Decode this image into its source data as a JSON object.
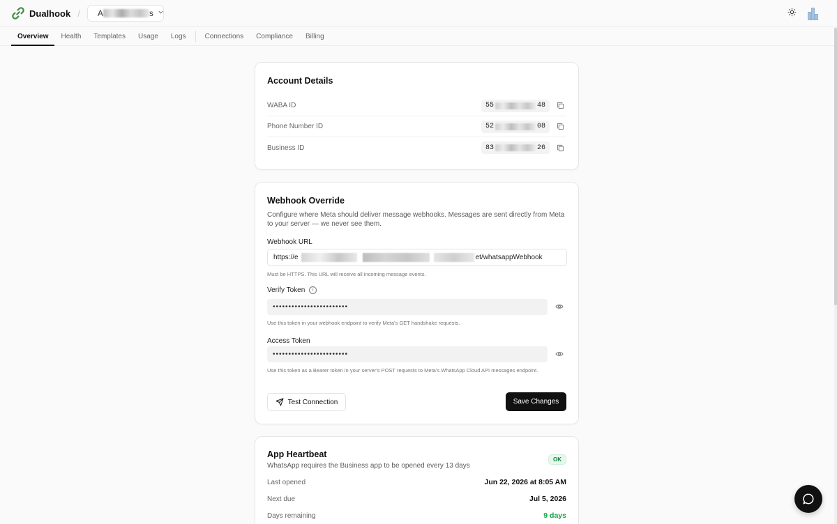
{
  "app": {
    "brand": "Dualhook",
    "separator": "/",
    "account_prefix": "A",
    "account_suffix": "s"
  },
  "tabs": [
    {
      "label": "Overview",
      "active": true
    },
    {
      "label": "Health"
    },
    {
      "label": "Templates"
    },
    {
      "label": "Usage"
    },
    {
      "label": "Logs"
    },
    {
      "label": "Connections"
    },
    {
      "label": "Compliance"
    },
    {
      "label": "Billing"
    }
  ],
  "account_details": {
    "title": "Account Details",
    "rows": [
      {
        "label": "WABA ID",
        "prefix": "55",
        "suffix": "48"
      },
      {
        "label": "Phone Number ID",
        "prefix": "52",
        "suffix": "08"
      },
      {
        "label": "Business ID",
        "prefix": "83",
        "suffix": "26"
      }
    ]
  },
  "webhook": {
    "title": "Webhook Override",
    "description": "Configure where Meta should deliver message webhooks. Messages are sent directly from Meta to your server — we never see them.",
    "url_label": "Webhook URL",
    "url_prefix": "https://e",
    "url_suffix": "et/whatsappWebhook",
    "url_hint": "Must be HTTPS. This URL will receive all incoming message events.",
    "verify_label": "Verify Token",
    "verify_value": "••••••••••••••••••••••••",
    "verify_hint": "Use this token in your webhook endpoint to verify Meta's GET handshake requests.",
    "access_label": "Access Token",
    "access_value": "••••••••••••••••••••••••",
    "access_hint": "Use this token as a Bearer token in your server's POST requests to Meta's WhatsApp Cloud API messages endpoint.",
    "test_label": "Test Connection",
    "save_label": "Save Changes"
  },
  "heartbeat": {
    "title": "App Heartbeat",
    "subtitle": "WhatsApp requires the Business app to be opened every 13 days",
    "status": "OK",
    "rows": [
      {
        "label": "Last opened",
        "value": "Jun 22, 2026 at 8:05 AM"
      },
      {
        "label": "Next due",
        "value": "Jul 5, 2026"
      },
      {
        "label": "Days remaining",
        "value": "9 days"
      }
    ]
  },
  "colors": {
    "accent_green": "#16a34a",
    "primary_button": "#111111",
    "logo_green": "#3d8b40"
  },
  "icons": {
    "logo": "link-icon",
    "theme": "sun-icon",
    "copy": "copy-icon",
    "info": "info-icon",
    "eye": "eye-icon",
    "send": "send-icon",
    "chat": "chat-bubble-icon"
  }
}
